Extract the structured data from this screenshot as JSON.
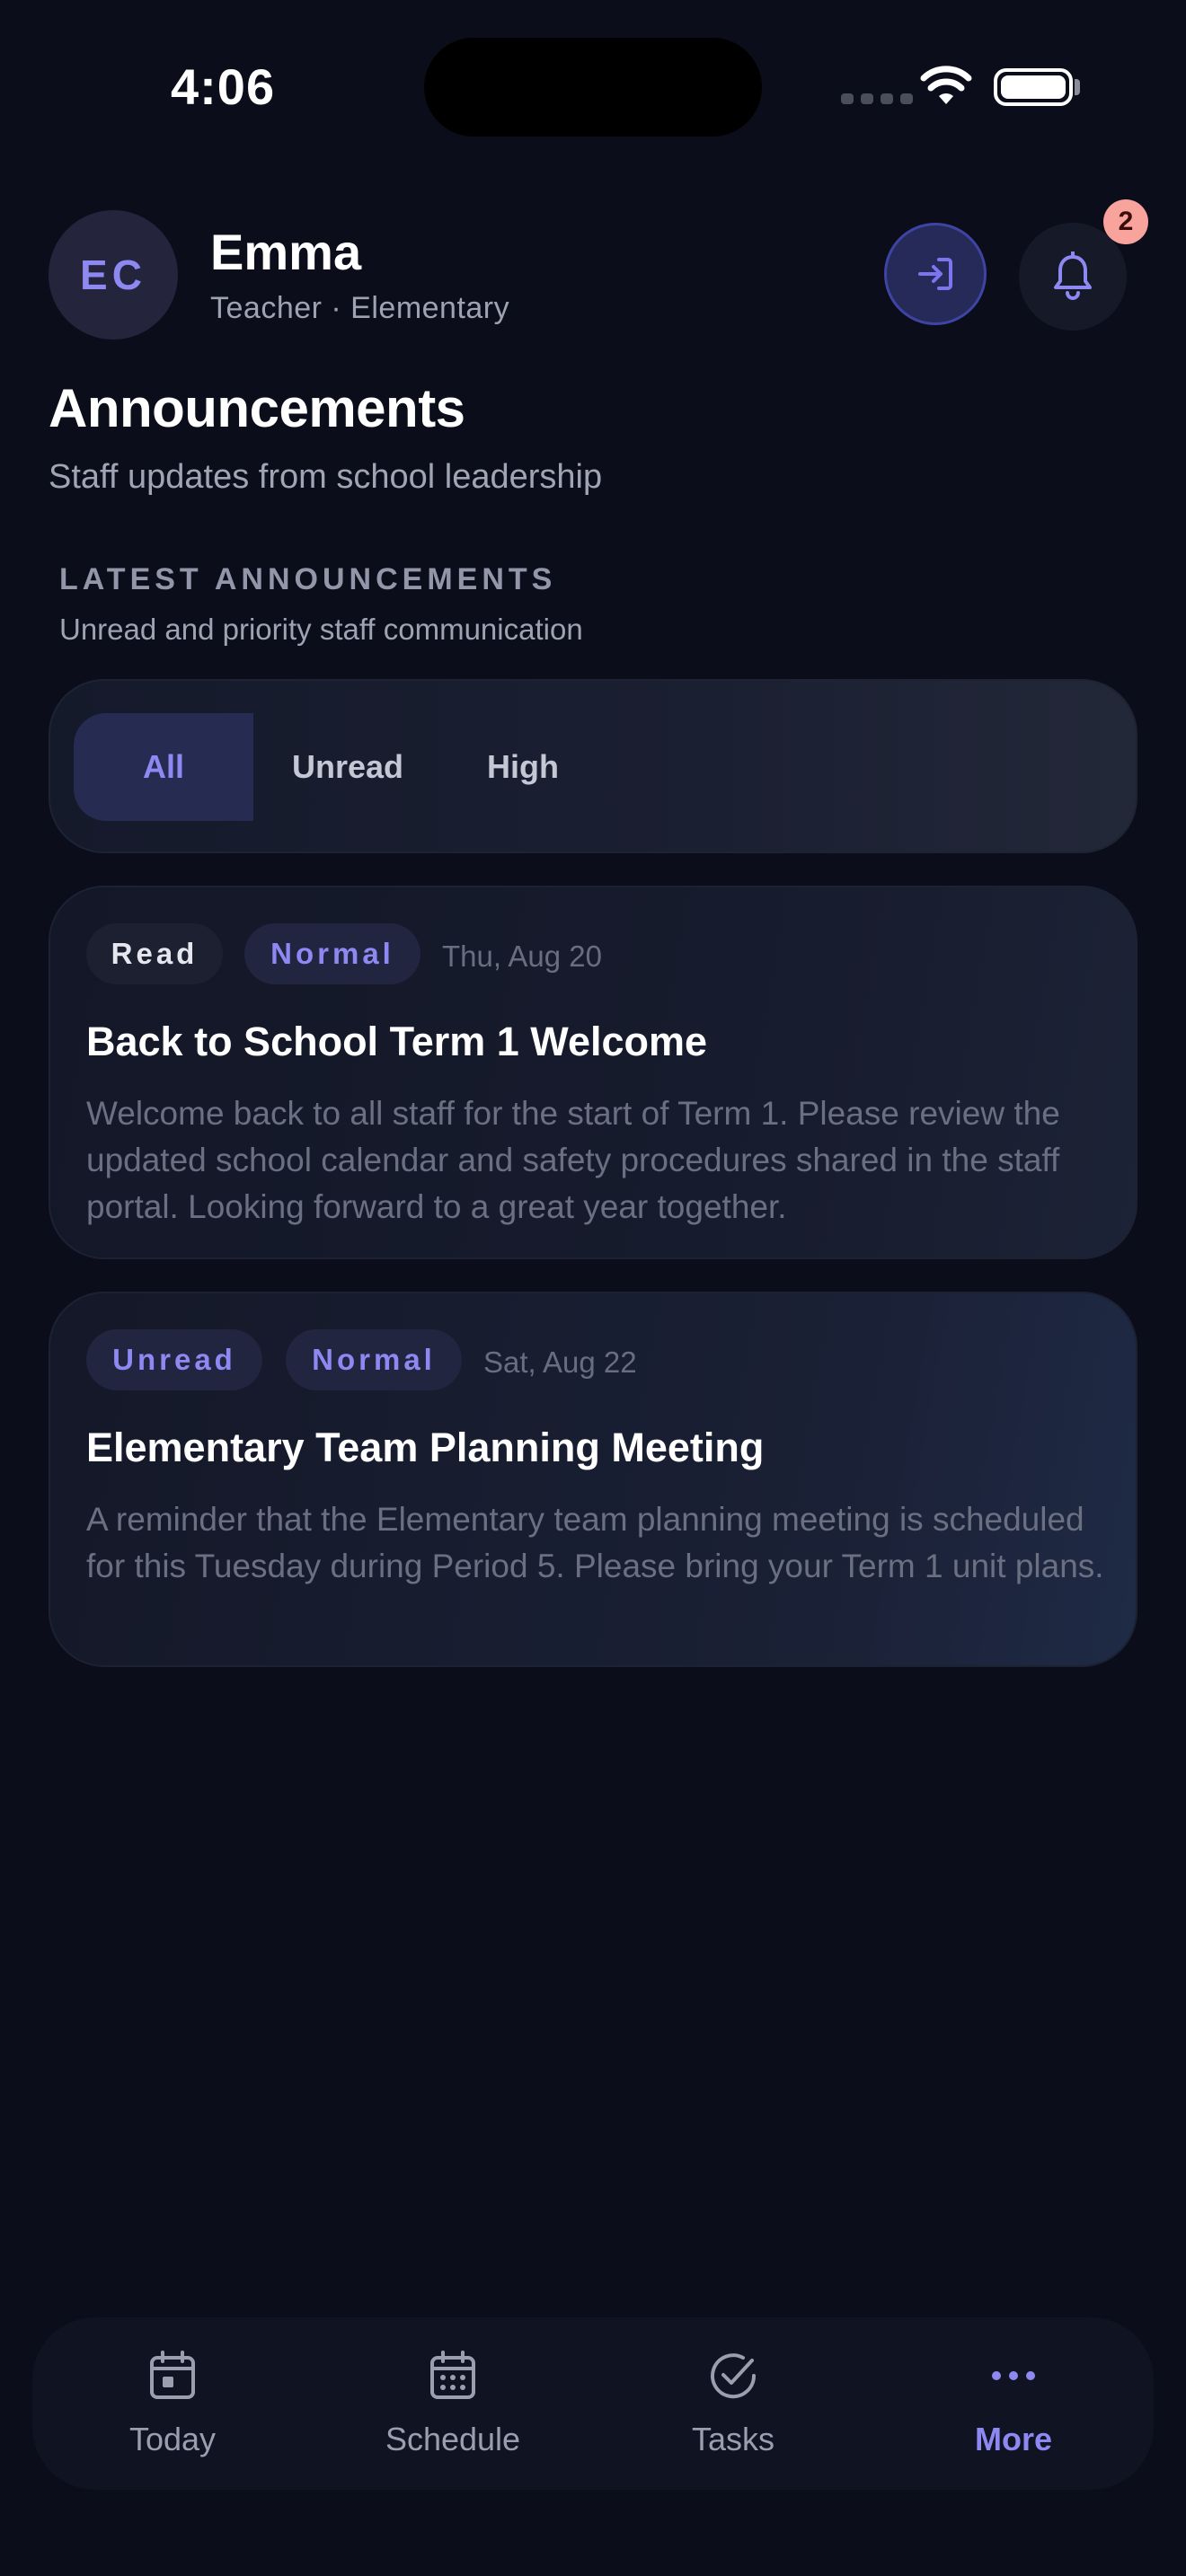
{
  "status_bar": {
    "time": "4:06"
  },
  "header": {
    "avatar_initials": "EC",
    "user_name": "Emma",
    "user_role": "Teacher · Elementary",
    "notification_count": "2"
  },
  "page": {
    "title": "Announcements",
    "subtitle": "Staff updates from school leadership"
  },
  "section": {
    "label": "LATEST ANNOUNCEMENTS",
    "sublabel": "Unread and priority staff communication"
  },
  "filters": {
    "tabs": [
      {
        "label": "All",
        "selected": true
      },
      {
        "label": "Unread",
        "selected": false
      },
      {
        "label": "High",
        "selected": false
      }
    ]
  },
  "announcements": [
    {
      "status": "Read",
      "priority": "Normal",
      "date": "Thu, Aug 20",
      "title": "Back to School Term 1 Welcome",
      "body": "Welcome back to all staff for the start of Term 1. Please review the updated school calendar and safety procedures shared in the staff portal. Looking forward to a great year together."
    },
    {
      "status": "Unread",
      "priority": "Normal",
      "date": "Sat, Aug 22",
      "title": "Elementary Team Planning Meeting",
      "body": "A reminder that the Elementary team planning meeting is scheduled for this Tuesday during Period 5. Please bring your Term 1 unit plans."
    }
  ],
  "bottom_nav": {
    "items": [
      {
        "label": "Today",
        "icon": "calendar-day-icon",
        "active": false
      },
      {
        "label": "Schedule",
        "icon": "calendar-grid-icon",
        "active": false
      },
      {
        "label": "Tasks",
        "icon": "check-circle-icon",
        "active": false
      },
      {
        "label": "More",
        "icon": "more-dots-icon",
        "active": true
      }
    ]
  },
  "colors": {
    "background": "#0b0e1a",
    "accent": "#8d88f2",
    "badge": "#f8a39c"
  }
}
